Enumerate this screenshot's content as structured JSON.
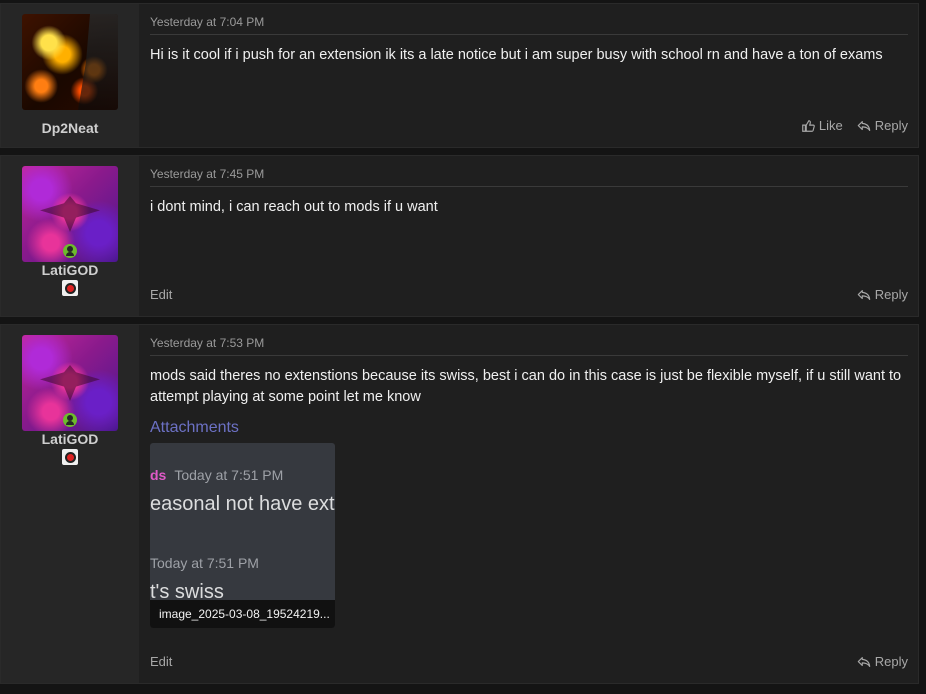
{
  "posts": [
    {
      "username": "Dp2Neat",
      "timestamp": "Yesterday at 7:04 PM",
      "body": "Hi is it cool if i push for an extension ik its a late notice but i am super busy with school rn and have a ton of exams",
      "like_label": "Like",
      "reply_label": "Reply"
    },
    {
      "username": "LatiGOD",
      "timestamp": "Yesterday at 7:45 PM",
      "body": "i dont mind, i can reach out to mods if u want",
      "edit_label": "Edit",
      "reply_label": "Reply"
    },
    {
      "username": "LatiGOD",
      "timestamp": "Yesterday at 7:53 PM",
      "body": "mods said theres no extenstions because its swiss, best i can do in this case is just be flexible myself, if u still want to attempt playing at some point let me know",
      "attachments_title": "Attachments",
      "attachment": {
        "line1_name": "ds",
        "line1_time": "Today at 7:51 PM",
        "line2": "easonal not have exte",
        "line3": "Today at 7:51 PM",
        "line4": "t's swiss",
        "filename": "image_2025-03-08_19524219..."
      },
      "edit_label": "Edit",
      "reply_label": "Reply"
    }
  ],
  "colors": {
    "background": "#141414",
    "post_bg": "#1f1f1f",
    "user_col_bg": "#262626",
    "link_accent": "#6c71c4",
    "online_green": "#6dbb2c"
  }
}
